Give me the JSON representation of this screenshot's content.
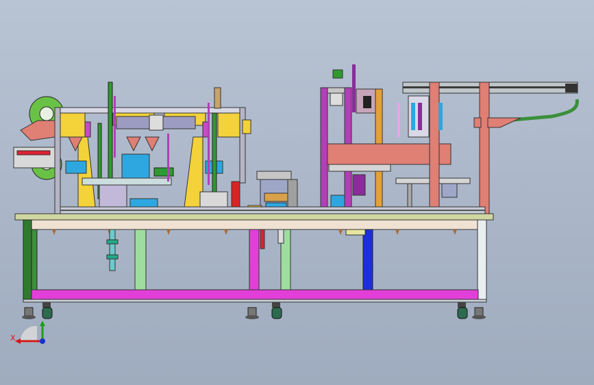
{
  "view": {
    "background_top": "#b8c3d3",
    "background_bottom": "#9fabbe"
  },
  "triad": {
    "x_label": "X",
    "x_axis_color": "#d01818",
    "y_axis_color": "#18a018",
    "z_axis_color": "#1830d0",
    "icon": "coordinate-triad-icon"
  },
  "colors": {
    "frame_magenta": "#e23fd8",
    "frame_green": "#2f7a2f",
    "frame_light_green": "#9fdca0",
    "frame_blue": "#1c2fd8",
    "tabletop": "#cfd6a0",
    "tabletop_beige": "#efe2d2",
    "plate_yellow": "#f3d23a",
    "plate_salmon": "#e07f74",
    "plate_blue": "#2ea7e0",
    "plate_purple": "#b23fb8",
    "wheel_green": "#69c246"
  }
}
